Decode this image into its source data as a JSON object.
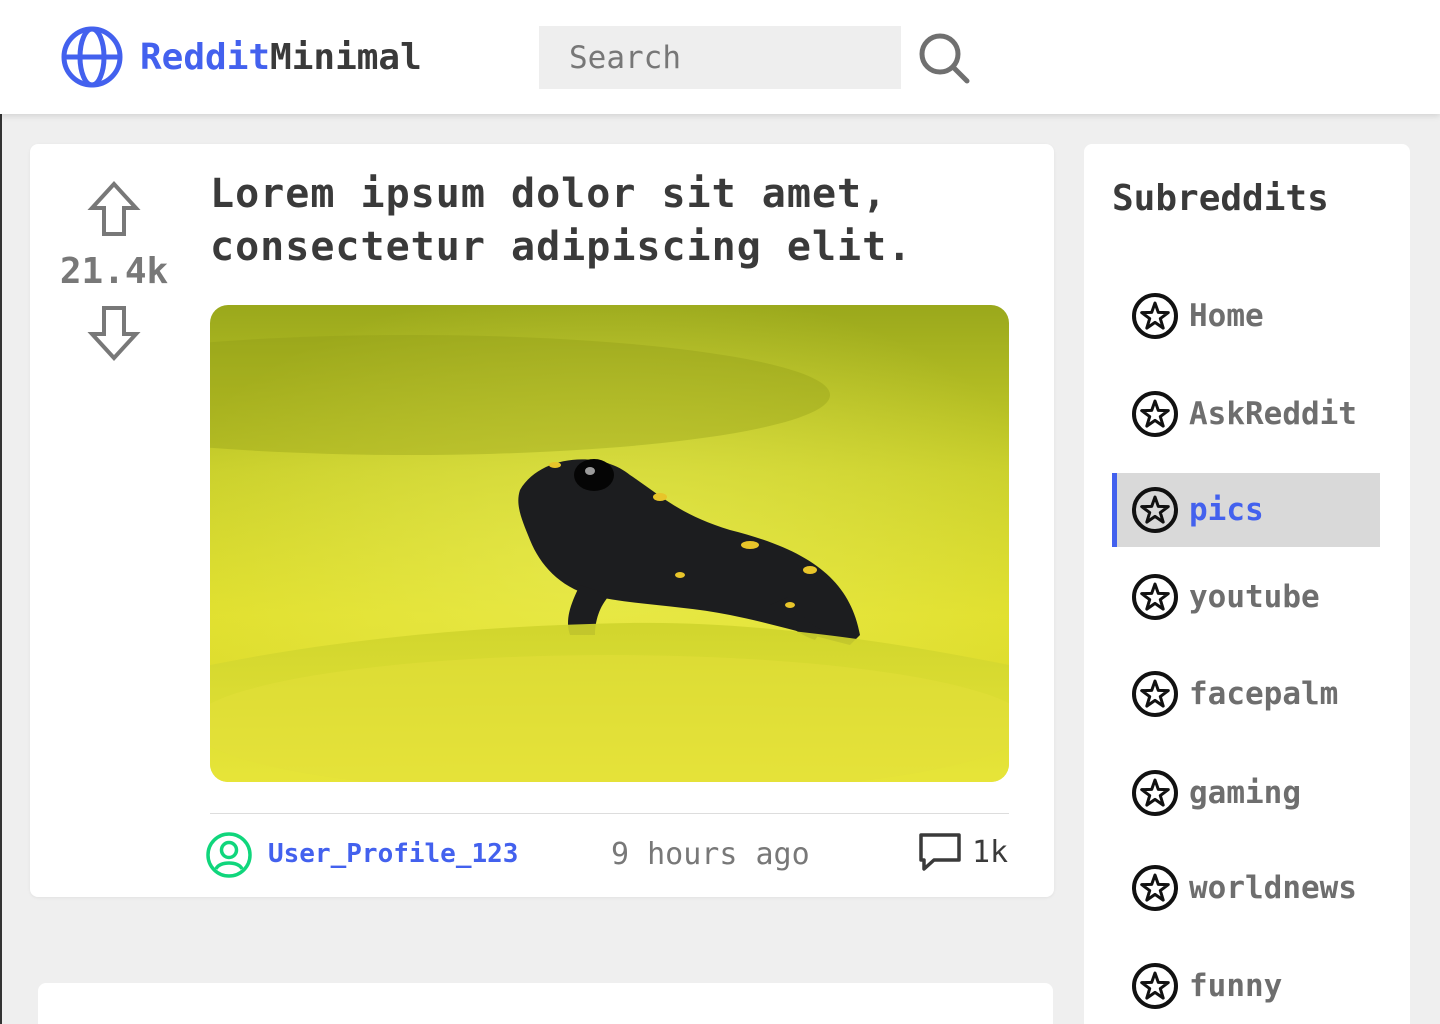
{
  "header": {
    "logo_part1": "Reddit",
    "logo_part2": "Minimal",
    "search_placeholder": "Search",
    "brand_color": "#4361ee"
  },
  "post": {
    "score": "21.4k",
    "title": "Lorem ipsum dolor sit amet, consectetur adipiscing elit.",
    "image_subject": "salamander on moss",
    "author": "User_Profile_123",
    "time": "9 hours ago",
    "comments": "1k"
  },
  "sidebar": {
    "title": "Subreddits",
    "items": [
      {
        "label": "Home"
      },
      {
        "label": "AskReddit"
      },
      {
        "label": "pics",
        "active": true
      },
      {
        "label": "youtube"
      },
      {
        "label": "facepalm"
      },
      {
        "label": "gaming"
      },
      {
        "label": "worldnews"
      },
      {
        "label": "funny"
      }
    ]
  }
}
